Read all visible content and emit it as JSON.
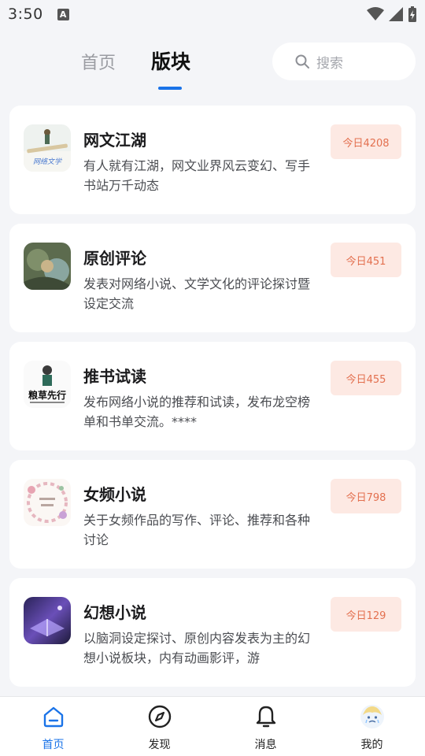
{
  "status": {
    "time": "3:50",
    "indicator": "A"
  },
  "header": {
    "tabs": [
      {
        "label": "首页",
        "active": false
      },
      {
        "label": "版块",
        "active": true
      }
    ],
    "search": {
      "placeholder": "搜索",
      "icon": "search-icon"
    }
  },
  "boards": [
    {
      "title": "网文江湖",
      "description": "有人就有江湖，网文业界风云变幻、写手书站万千动态",
      "badge": "今日4208",
      "thumb_text": "网络文学"
    },
    {
      "title": "原创评论",
      "description": "发表对网络小说、文学文化的评论探讨暨设定交流",
      "badge": "今日451",
      "thumb_text": ""
    },
    {
      "title": "推书试读",
      "description": "发布网络小说的推荐和试读，发布龙空榜单和书单交流。****",
      "badge": "今日455",
      "thumb_text": "粮草先行"
    },
    {
      "title": "女频小说",
      "description": "关于女频作品的写作、评论、推荐和各种讨论",
      "badge": "今日798",
      "thumb_text": ""
    },
    {
      "title": "幻想小说",
      "description": "以脑洞设定探讨、原创内容发表为主的幻想小说板块，内有动画影评，游",
      "badge": "今日129",
      "thumb_text": ""
    }
  ],
  "nav": [
    {
      "label": "首页",
      "icon": "home-icon",
      "active": true
    },
    {
      "label": "发现",
      "icon": "compass-icon",
      "active": false
    },
    {
      "label": "消息",
      "icon": "bell-icon",
      "active": false
    },
    {
      "label": "我的",
      "icon": "avatar-icon",
      "active": false
    }
  ],
  "colors": {
    "accent": "#1a73e8",
    "badge_bg": "#fde9e3",
    "badge_text": "#e3704f",
    "background": "#f4f5f8"
  }
}
